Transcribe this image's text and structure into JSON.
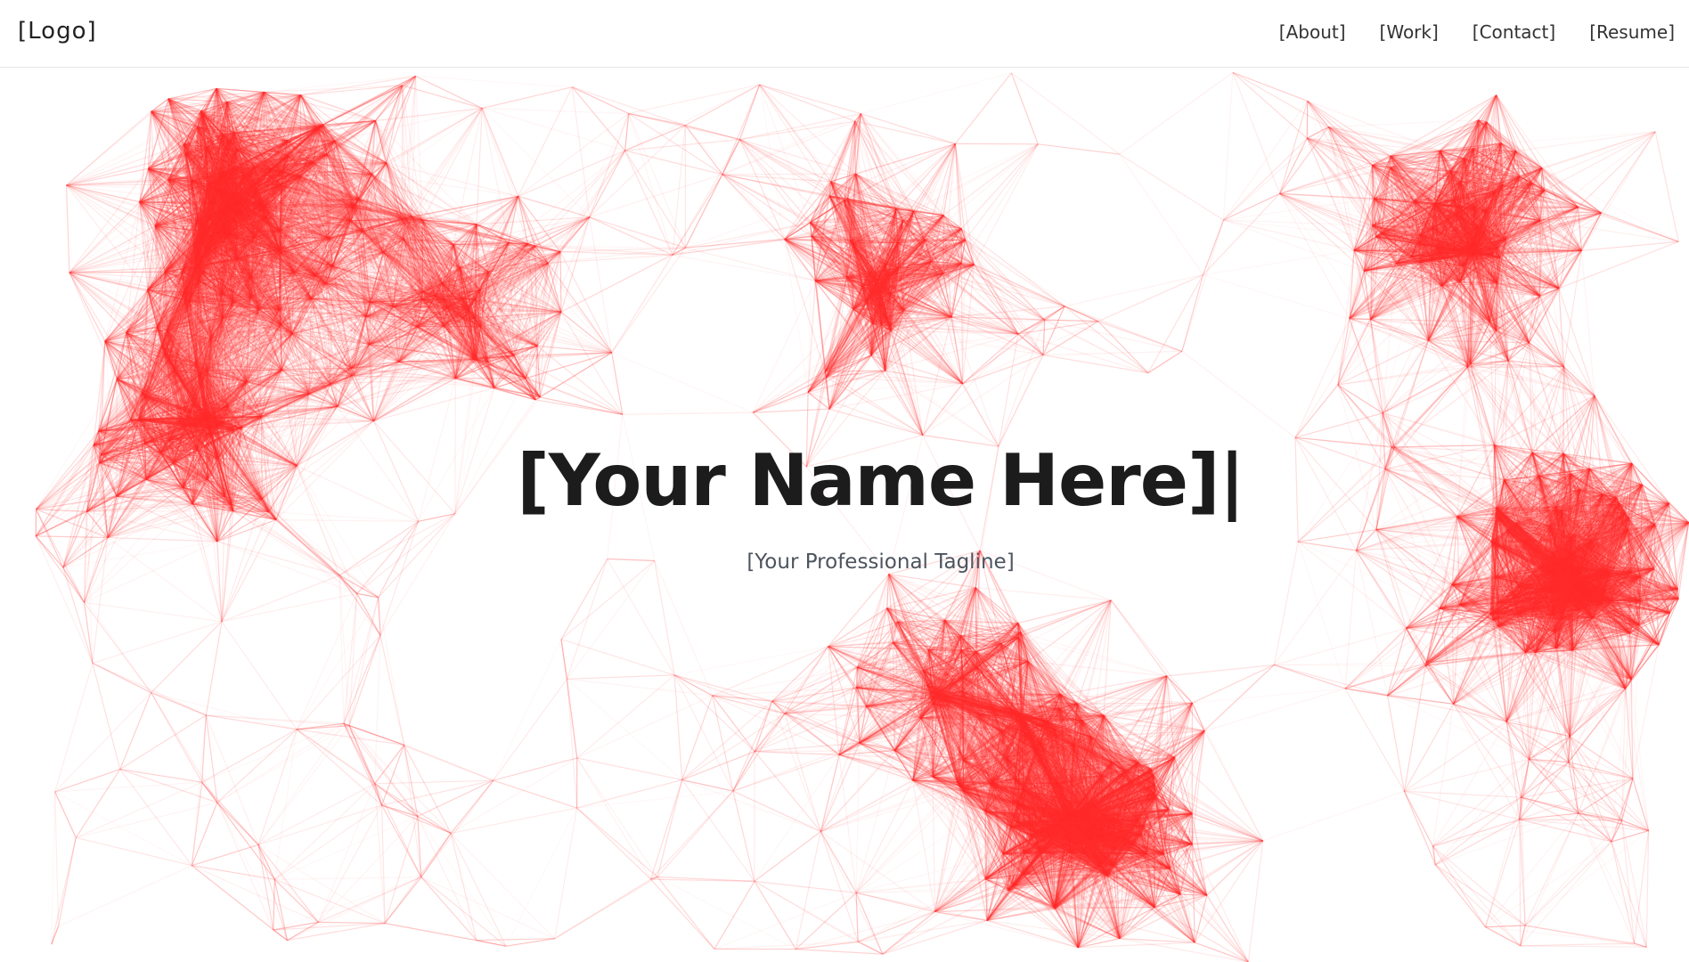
{
  "header": {
    "logo": "[Logo]",
    "nav": [
      {
        "label": "[About]"
      },
      {
        "label": "[Work]"
      },
      {
        "label": "[Contact]"
      },
      {
        "label": "[Resume]"
      }
    ]
  },
  "hero": {
    "name": "[Your Name Here]",
    "cursor": "|",
    "tagline": "[Your Professional Tagline]"
  },
  "colors": {
    "network_line": "#ff2e2e",
    "text_dark": "#1c1c1c",
    "tagline": "#4d545e"
  }
}
